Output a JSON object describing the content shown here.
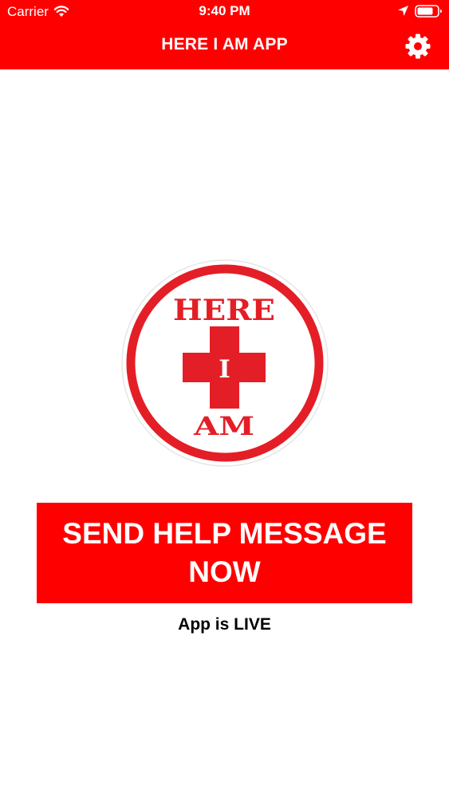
{
  "status_bar": {
    "carrier": "Carrier",
    "time": "9:40 PM",
    "wifi_icon": "wifi-icon",
    "location_icon": "location-arrow-icon",
    "battery_icon": "battery-icon"
  },
  "nav": {
    "title": "HERE I AM APP",
    "settings_icon": "gear-icon"
  },
  "logo": {
    "top_text": "HERE",
    "middle_text": "I",
    "bottom_text": "AM"
  },
  "main": {
    "send_button_label": "SEND HELP MESSAGE NOW",
    "status_text": "App is LIVE"
  },
  "colors": {
    "brand_red": "#ff0000",
    "logo_red": "#e41e26",
    "text": "#000000",
    "background": "#ffffff"
  }
}
